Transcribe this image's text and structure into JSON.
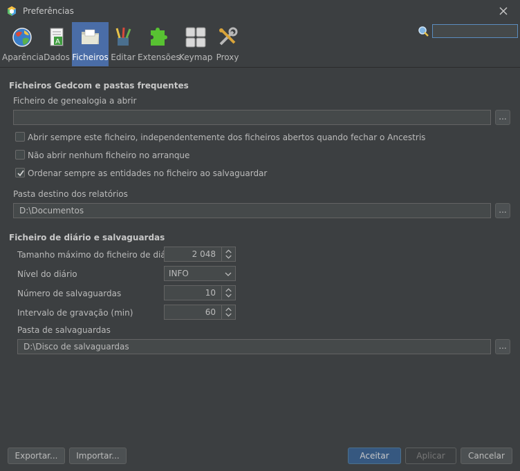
{
  "window": {
    "title": "Preferências"
  },
  "toolbar": {
    "tabs": [
      {
        "label": "Aparência",
        "icon": "globe-icon"
      },
      {
        "label": "Dados",
        "icon": "document-icon"
      },
      {
        "label": "Ficheiros",
        "icon": "folder-icon"
      },
      {
        "label": "Editar",
        "icon": "pencils-icon"
      },
      {
        "label": "Extensões",
        "icon": "puzzle-icon"
      },
      {
        "label": "Keymap",
        "icon": "keyboard-icon"
      },
      {
        "label": "Proxy",
        "icon": "wrench-icon"
      }
    ],
    "selected": "Ficheiros"
  },
  "search": {
    "value": "",
    "placeholder": ""
  },
  "gedcom": {
    "section_title": "Ficheiros Gedcom e pastas frequentes",
    "open_file_label": "Ficheiro de genealogia a abrir",
    "open_file_value": "",
    "browse_label": "...",
    "chk_always_open": {
      "label": "Abrir sempre este ficheiro, independentemente dos ficheiros abertos quando fechar o Ancestris",
      "checked": false
    },
    "chk_no_open": {
      "label": "Não abrir nenhum ficheiro no arranque",
      "checked": false
    },
    "chk_sort": {
      "label": "Ordenar sempre as entidades no ficheiro ao salvaguardar",
      "checked": true
    },
    "reports_label": "Pasta destino dos relatórios",
    "reports_value": "D:\\Documentos"
  },
  "journal": {
    "section_title": "Ficheiro de diário e salvaguardas",
    "max_size_label": "Tamanho máximo do ficheiro de diário",
    "max_size_value": "2 048",
    "level_label": "Nível do diário",
    "level_value": "INFO",
    "backups_label": "Número de salvaguardas",
    "backups_value": "10",
    "interval_label": "Intervalo de gravação (min)",
    "interval_value": "60",
    "backup_folder_label": "Pasta de salvaguardas",
    "backup_folder_value": "D:\\Disco de salvaguardas"
  },
  "footer": {
    "export_label": "Exportar...",
    "import_label": "Importar...",
    "accept_label": "Aceitar",
    "apply_label": "Aplicar",
    "cancel_label": "Cancelar"
  }
}
